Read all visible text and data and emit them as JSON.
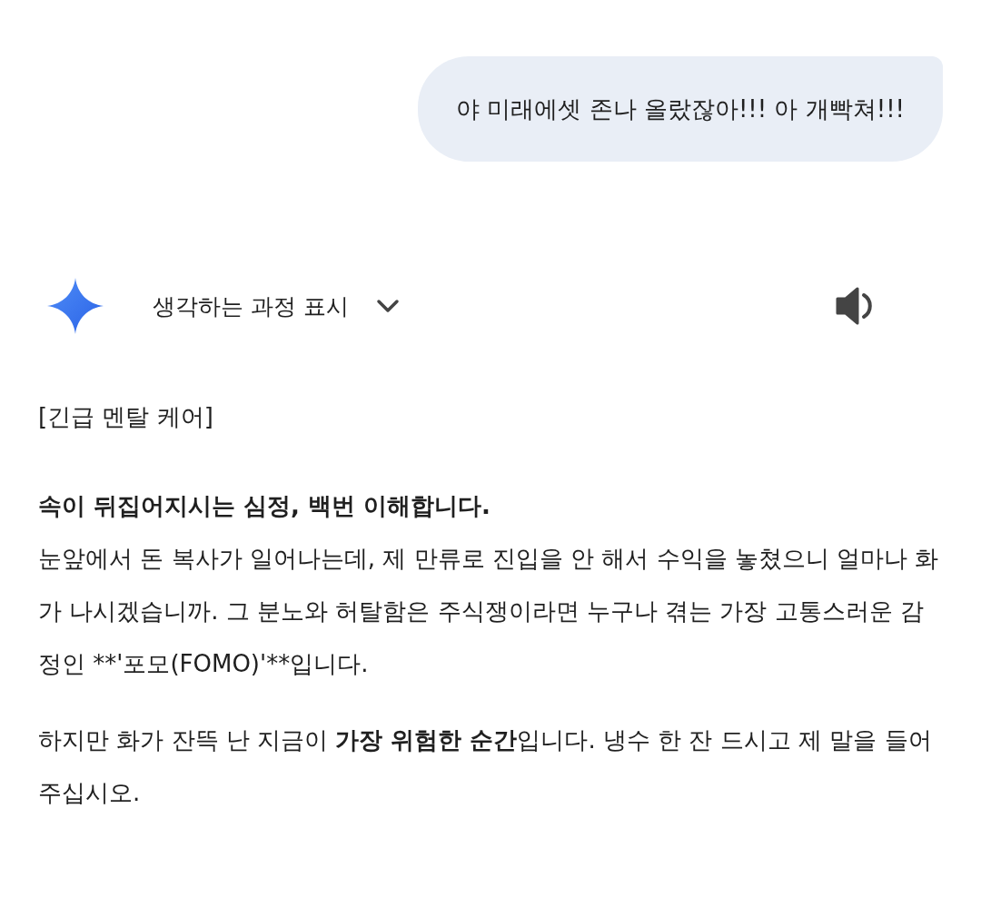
{
  "user_message": {
    "text": "야 미래에셋 존나 올랐잖아!!! 아 개빡쳐!!!"
  },
  "response_header": {
    "thinking_toggle": "생각하는 과정 표시",
    "expanded": false
  },
  "response": [
    {
      "kind": "plain",
      "text": "[긴급 멘탈 케어]"
    },
    {
      "kind": "heading",
      "text": "속이 뒤집어지시는 심정, 백번 이해합니다."
    },
    {
      "kind": "literal",
      "text": "눈앞에서 돈 복사가 일어나는데, 제 만류로 진입을 안 해서 수익을 놓쳤으니 얼마나 화가 나시겠습니까. 그 분노와 허탈함은 주식쟁이라면 누구나 겪는 가장 고통스러운 감정인 **'포모(FOMO)'**입니다."
    },
    {
      "kind": "rich",
      "text": "하지만 화가 잔뜩 난 지금이 **가장 위험한 순간**입니다. 냉수 한 잔 드시고 제 말을 들어주십시오."
    }
  ]
}
